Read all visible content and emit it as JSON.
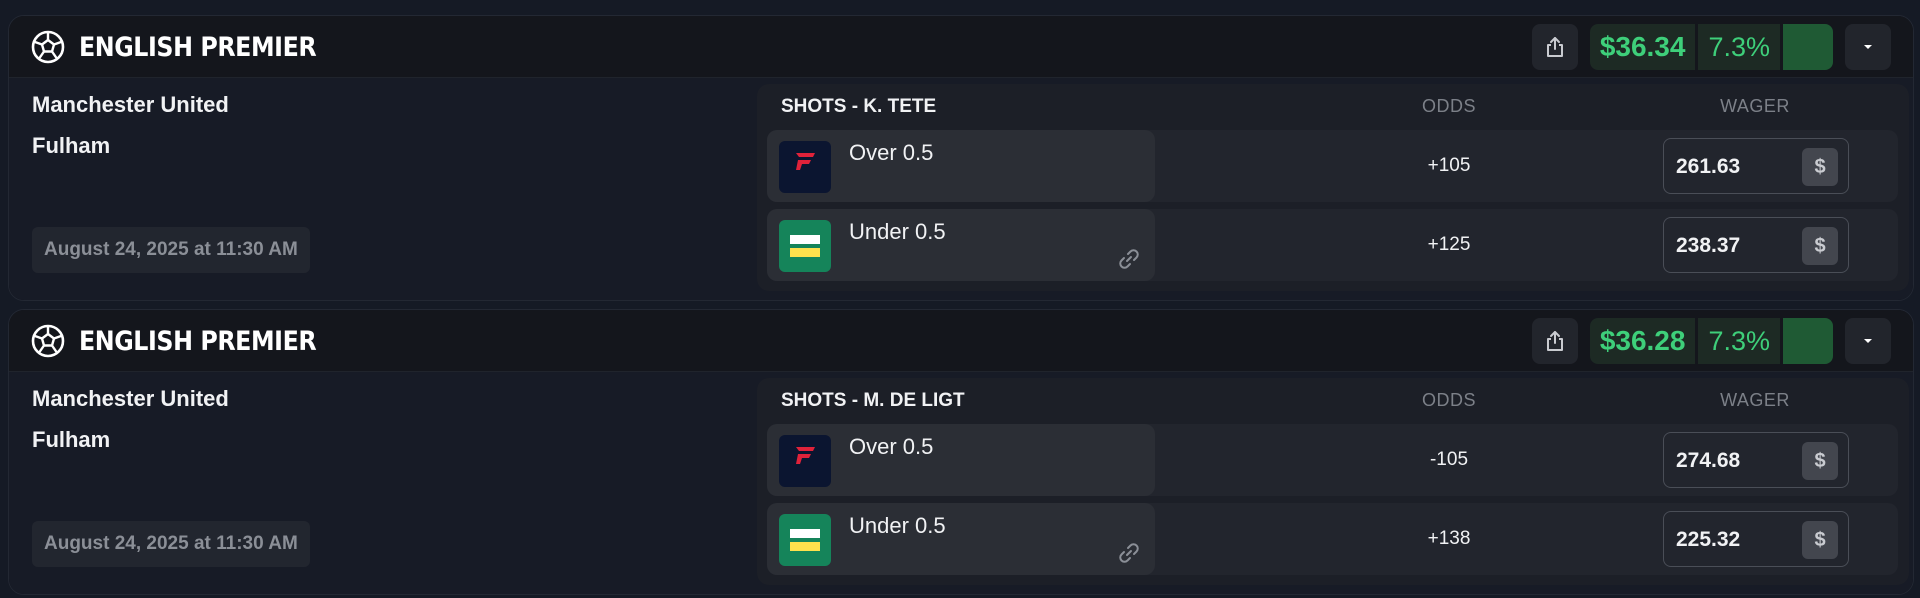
{
  "cards": [
    {
      "league": "ENGLISH PREMIER",
      "profit": "$36.34",
      "percent": "7.3%",
      "home_team": "Manchester United",
      "away_team": "Fulham",
      "date": "August 24, 2025 at 11:30 AM",
      "market": "SHOTS - K. TETE",
      "odds_header": "ODDS",
      "wager_header": "WAGER",
      "rows": [
        {
          "book": "Fanatics",
          "selection": "Over 0.5",
          "odds": "+105",
          "wager": "261.63",
          "currency": "$"
        },
        {
          "book": "bet365",
          "selection": "Under 0.5",
          "odds": "+125",
          "wager": "238.37",
          "currency": "$"
        }
      ]
    },
    {
      "league": "ENGLISH PREMIER",
      "profit": "$36.28",
      "percent": "7.3%",
      "home_team": "Manchester United",
      "away_team": "Fulham",
      "date": "August 24, 2025 at 11:30 AM",
      "market": "SHOTS - M. DE LIGT",
      "odds_header": "ODDS",
      "wager_header": "WAGER",
      "rows": [
        {
          "book": "Fanatics",
          "selection": "Over 0.5",
          "odds": "-105",
          "wager": "274.68",
          "currency": "$"
        },
        {
          "book": "bet365",
          "selection": "Under 0.5",
          "odds": "+138",
          "wager": "225.32",
          "currency": "$"
        }
      ]
    }
  ],
  "colors": {
    "accent_green": "#3ecf7a",
    "bet365_green": "#15845a",
    "bet365_yellow": "#ffe14d",
    "fanatics_red": "#e0223a"
  }
}
